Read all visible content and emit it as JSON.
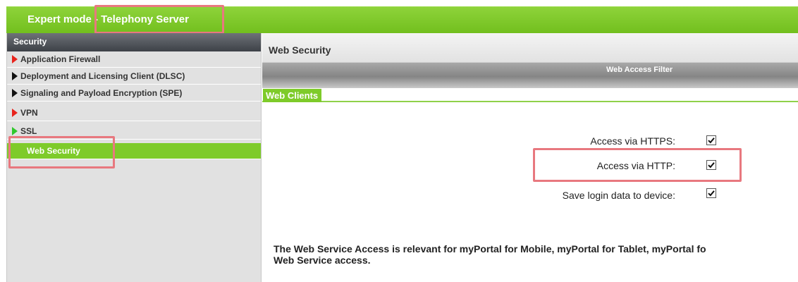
{
  "header": {
    "title": "Expert mode - Telephony Server"
  },
  "sidebar": {
    "heading": "Security",
    "items": [
      {
        "label": "Application Firewall",
        "arrow": "red"
      },
      {
        "label": "Deployment and Licensing Client (DLSC)",
        "arrow": "black"
      },
      {
        "label": "Signaling and Payload Encryption (SPE)",
        "arrow": "black"
      },
      {
        "label": "VPN",
        "arrow": "red"
      },
      {
        "label": "SSL",
        "arrow": "green"
      },
      {
        "label": "Web Security",
        "arrow": "none",
        "active": true
      }
    ]
  },
  "main": {
    "title": "Web Security",
    "tab_title": "Web Access Filter",
    "group_title": "Web Clients",
    "fields": [
      {
        "label": "Access via HTTPS:",
        "checked": true
      },
      {
        "label": "Access via HTTP:",
        "checked": true
      },
      {
        "label": "Save login data to device:",
        "checked": true
      }
    ],
    "info_line1": "The Web Service Access is relevant for myPortal for Mobile, myPortal for Tablet, myPortal fo",
    "info_line2": "Web Service access."
  },
  "colors": {
    "accent_green": "#7ecb2a",
    "highlight_box": "#e8787f",
    "arrow_red": "#e8231c",
    "arrow_green": "#2fc82b"
  }
}
